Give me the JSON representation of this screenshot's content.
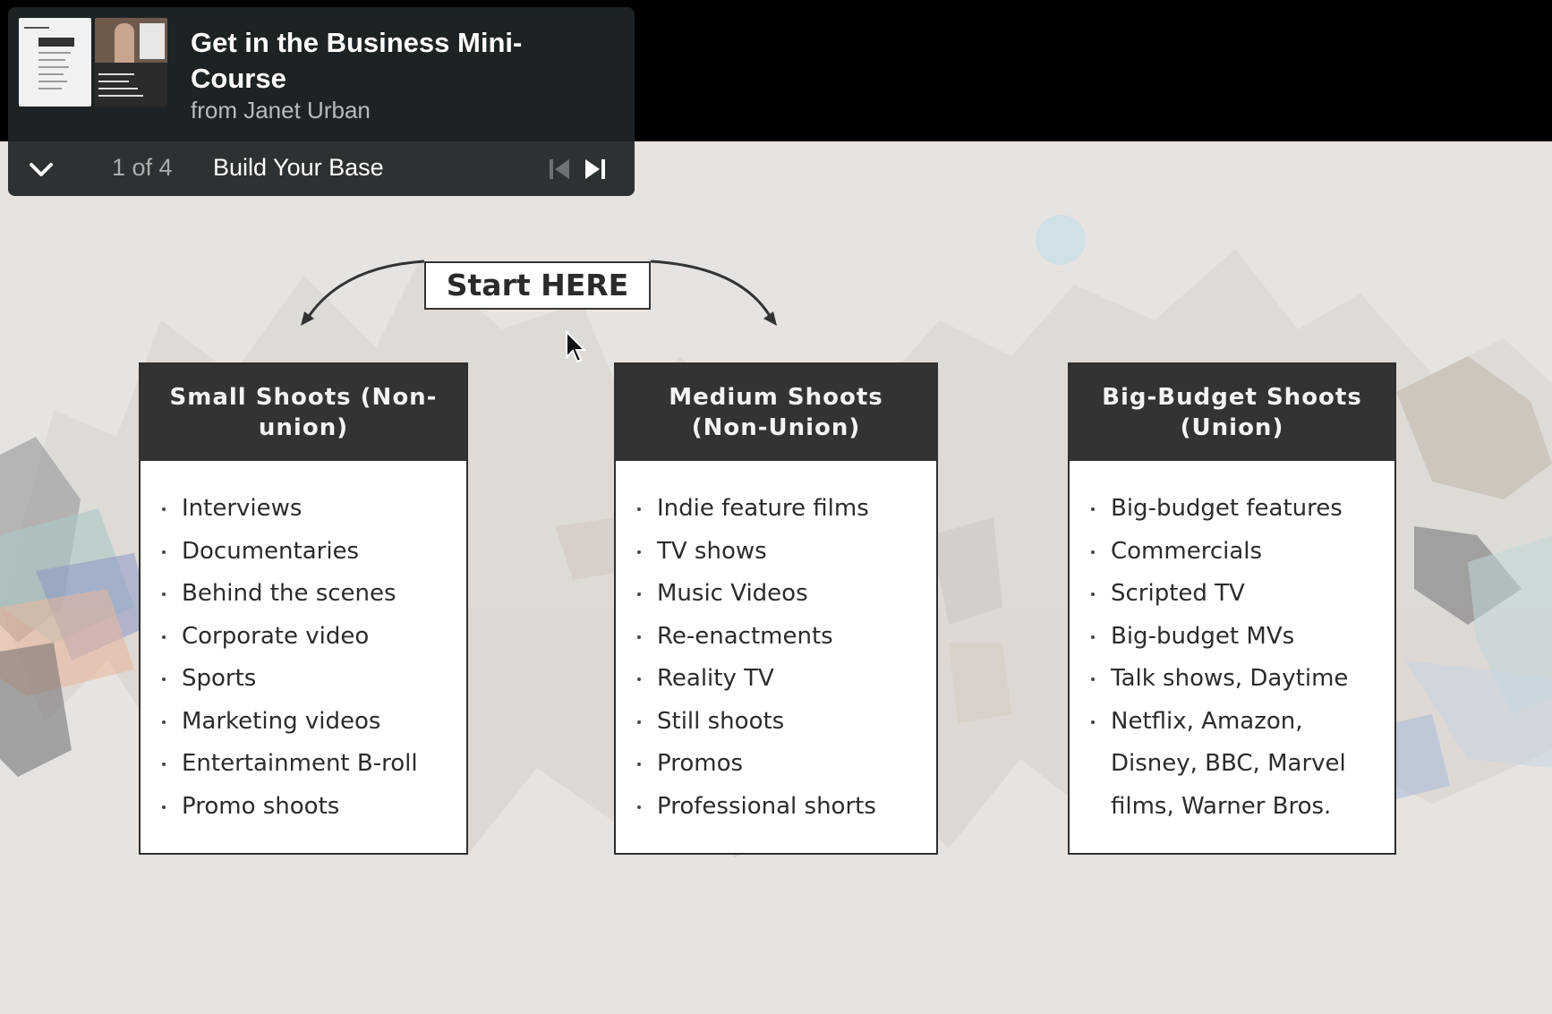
{
  "playlist": {
    "title": "Get in the Business Mini-Course",
    "author": "from Janet Urban",
    "counter": "1 of 4",
    "current_video": "Build Your Base",
    "icons": {
      "collapse": "chevron-down-icon",
      "previous": "skip-previous-icon",
      "next": "skip-next-icon"
    }
  },
  "slide": {
    "start_label": "Start HERE",
    "cards": [
      {
        "title": "Small Shoots (Non-union)",
        "items": [
          "Interviews",
          "Documentaries",
          "Behind the scenes",
          "Corporate video",
          "Sports",
          "Marketing videos",
          "Entertainment B-roll",
          "Promo shoots"
        ]
      },
      {
        "title": "Medium Shoots (Non-Union)",
        "items": [
          "Indie feature films",
          "TV shows",
          "Music Videos",
          "Re-enactments",
          "Reality TV",
          "Still shoots",
          "Promos",
          "Professional shorts"
        ]
      },
      {
        "title": "Big-Budget Shoots (Union)",
        "items": [
          "Big-budget features",
          "Commercials",
          "Scripted TV",
          "Big-budget MVs",
          "Talk shows, Daytime",
          "Netflix, Amazon, Disney, BBC, Marvel films, Warner Bros."
        ]
      }
    ]
  },
  "colors": {
    "panel_bg": "#1d2325",
    "card_header": "#333333",
    "slide_bg": "#e7e3e0"
  }
}
